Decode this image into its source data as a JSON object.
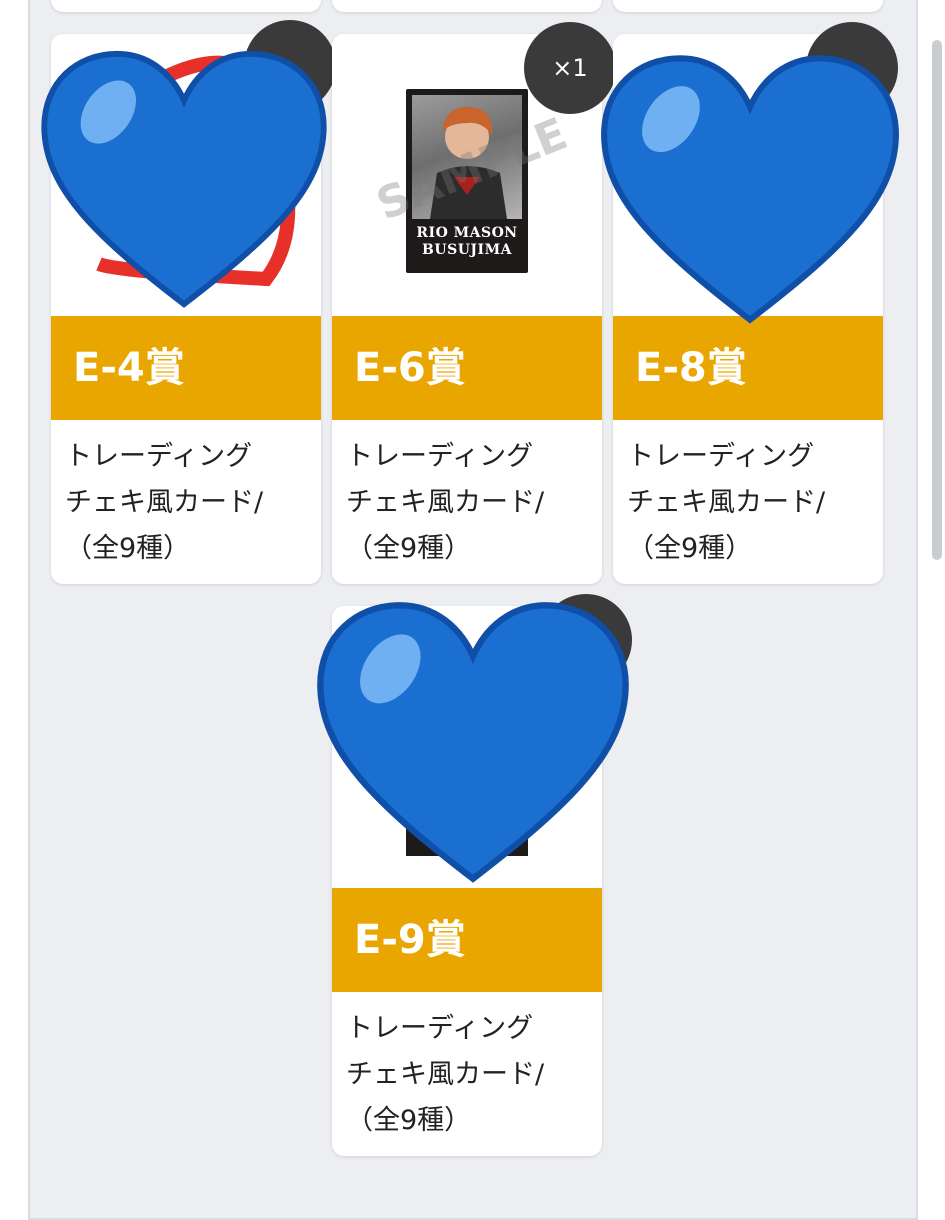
{
  "prizes": [
    {
      "label": "E-4賞",
      "description": "トレーディング\nチェキ風カード/\n（全9種）"
    },
    {
      "label": "E-6賞",
      "description": "トレーディング\nチェキ風カード/\n（全9種）",
      "count": "×1",
      "photo_caption": "RIO MASON\nBUSUJIMA",
      "watermark": "SAMPLE"
    },
    {
      "label": "E-8賞",
      "description": "トレーディング\nチェキ風カード/\n（全9種）"
    },
    {
      "label": "E-9賞",
      "description": "トレーディング\nチェキ風カード/\n（全9種）"
    }
  ],
  "colors": {
    "banner": "#e9a500",
    "heart": "#1a6fd0",
    "badge": "#3a3a3a"
  },
  "icons": {
    "cover": "blue-heart-emoji"
  }
}
